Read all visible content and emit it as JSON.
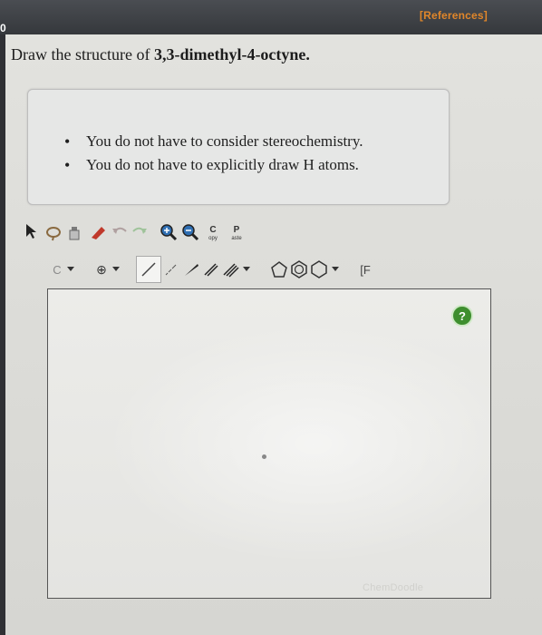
{
  "header": {
    "references_label": "[References]",
    "question_number_fragment": "0"
  },
  "question": {
    "prefix": "Draw the structure of ",
    "compound": "3,3-dimethyl-4-octyne."
  },
  "instructions": [
    "You do not have to consider stereochemistry.",
    "You do not have to explicitly draw H atoms."
  ],
  "toolbar": {
    "copy_label_top": "C",
    "copy_label_bottom": "opy",
    "paste_label_top": "P",
    "paste_label_bottom": "aste",
    "template_label": "[F",
    "charge_symbol": "⊕",
    "element_label": "C"
  },
  "canvas": {
    "help_label": "?",
    "watermark": "ChemDoodle"
  },
  "colors": {
    "references": "#e0862a",
    "help_button": "#3e8e2e"
  }
}
